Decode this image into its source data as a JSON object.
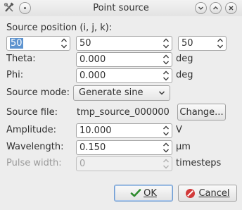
{
  "window": {
    "title": "Point source",
    "app_icon": "tools-icon",
    "menu_icon": "menu-icon",
    "minimize_icon": "chevron-down-icon",
    "maximize_icon": "chevron-up-icon",
    "close_icon": "close-icon"
  },
  "source_position": {
    "label": "Source position (i, j, k):",
    "i": "50",
    "j": "50",
    "k": "50"
  },
  "theta": {
    "label": "Theta:",
    "value": "0.000",
    "unit": "deg"
  },
  "phi": {
    "label": "Phi:",
    "value": "0.000",
    "unit": "deg"
  },
  "source_mode": {
    "label": "Source mode:",
    "selected": "Generate sine"
  },
  "source_file": {
    "label": "Source file:",
    "value": "tmp_source_000000",
    "button": "Change..."
  },
  "amplitude": {
    "label": "Amplitude:",
    "value": "10.000",
    "unit": "V"
  },
  "wavelength": {
    "label": "Wavelength:",
    "value": "0.150",
    "unit": "µm"
  },
  "pulse_width": {
    "label": "Pulse width:",
    "value": "0",
    "unit": "timesteps",
    "enabled": false
  },
  "buttons": {
    "ok": "OK",
    "cancel": "Cancel",
    "ok_icon": "check-icon",
    "cancel_icon": "cancel-icon"
  },
  "colors": {
    "selection": "#5d93cf",
    "ok_check": "#2e8b2e",
    "cancel_red": "#d23a3a"
  }
}
